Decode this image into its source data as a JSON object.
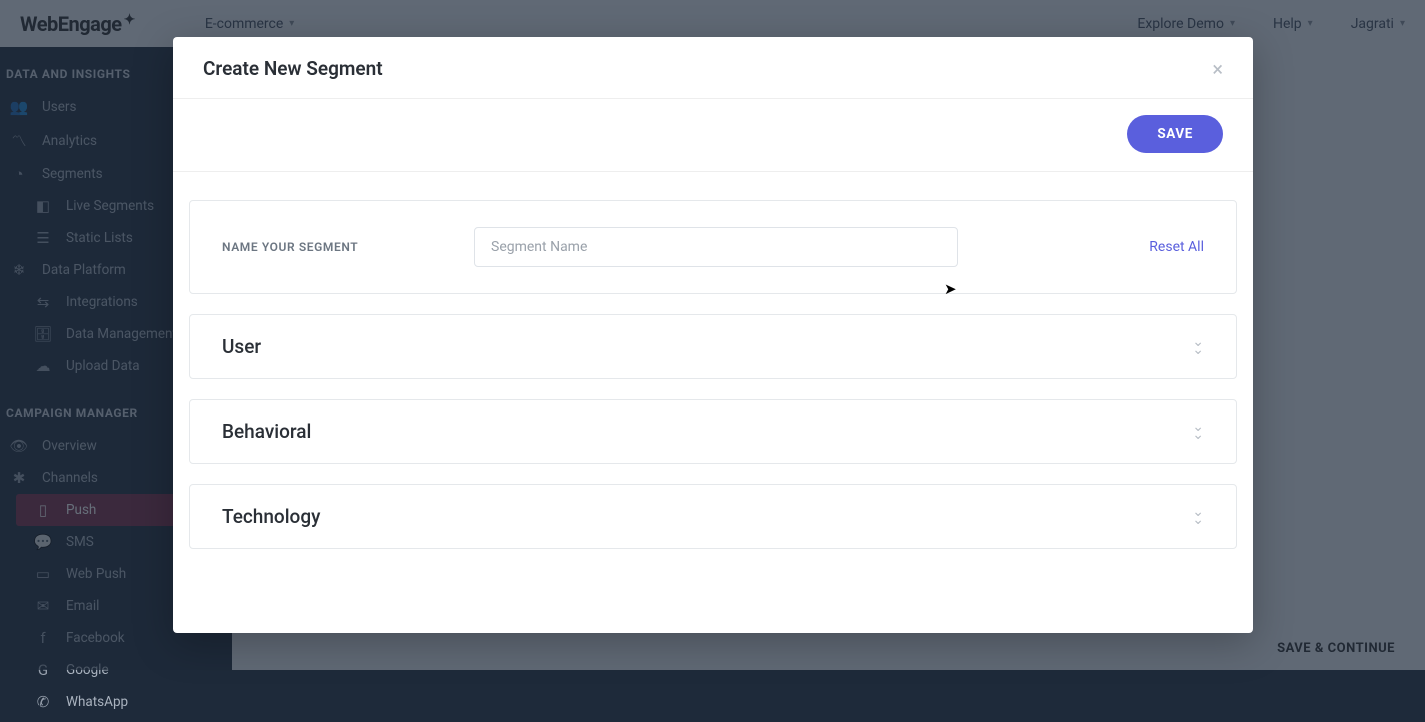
{
  "header": {
    "logo": "WebEngage",
    "project": "E-commerce",
    "links": {
      "explore": "Explore Demo",
      "help": "Help",
      "user": "Jagrati"
    }
  },
  "sidebar": {
    "section1": {
      "heading": "DATA AND INSIGHTS",
      "users": "Users",
      "analytics": "Analytics",
      "segments": "Segments",
      "live": "Live Segments",
      "static": "Static Lists",
      "platform": "Data Platform",
      "integrations": "Integrations",
      "dataMgmt": "Data Management",
      "upload": "Upload Data"
    },
    "section2": {
      "heading": "CAMPAIGN MANAGER",
      "overview": "Overview",
      "channels": "Channels",
      "push": "Push",
      "sms": "SMS",
      "webpush": "Web Push",
      "email": "Email",
      "facebook": "Facebook",
      "google": "Google",
      "whatsapp": "WhatsApp"
    }
  },
  "footer": {
    "saveContinue": "SAVE & CONTINUE"
  },
  "modal": {
    "title": "Create New Segment",
    "save": "SAVE",
    "nameLabel": "NAME YOUR SEGMENT",
    "namePlaceholder": "Segment Name",
    "reset": "Reset All",
    "sections": {
      "user": "User",
      "behavioral": "Behavioral",
      "technology": "Technology"
    }
  }
}
